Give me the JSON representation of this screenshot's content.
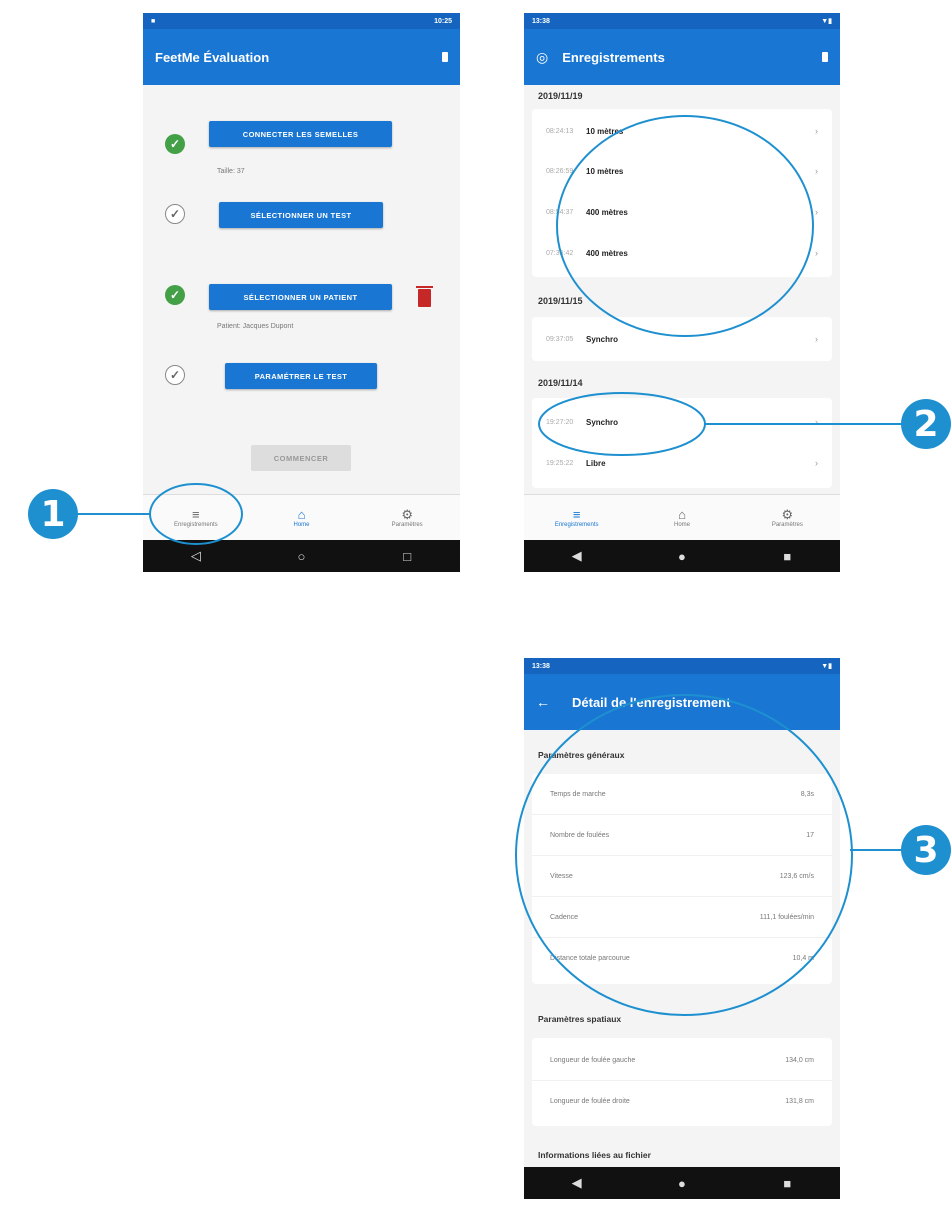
{
  "phone1": {
    "status_time": "10:25",
    "app_title": "FeetMe Évaluation",
    "connect_button": "CONNECTER LES SEMELLES",
    "size_text": "Taille: 37",
    "select_test_button": "SÉLECTIONNER UN TEST",
    "select_patient_button": "SÉLECTIONNER UN PATIENT",
    "patient_text": "Patient: Jacques Dupont",
    "configure_test_button": "PARAMÉTRER LE TEST",
    "start_button": "COMMENCER",
    "nav": [
      {
        "label": "Enregistrements",
        "icon": "list-icon"
      },
      {
        "label": "Home",
        "icon": "home-icon"
      },
      {
        "label": "Paramètres",
        "icon": "gear-icon"
      }
    ]
  },
  "phone2": {
    "status_time": "13:38",
    "app_title": "Enregistrements",
    "groups": [
      {
        "date": "2019/11/19",
        "items": [
          {
            "time": "08:24:13",
            "name": "10 mètres"
          },
          {
            "time": "08:26:59",
            "name": "10 mètres"
          },
          {
            "time": "08:54:37",
            "name": "400 mètres"
          },
          {
            "time": "07:35:42",
            "name": "400 mètres"
          }
        ]
      },
      {
        "date": "2019/11/15",
        "items": [
          {
            "time": "09:37:05",
            "name": "Synchro"
          }
        ]
      },
      {
        "date": "2019/11/14",
        "items": [
          {
            "time": "19:27:20",
            "name": "Synchro"
          },
          {
            "time": "19:25:22",
            "name": "Libre"
          }
        ]
      }
    ],
    "nav": [
      {
        "label": "Enregistrements",
        "icon": "list-icon"
      },
      {
        "label": "Home",
        "icon": "home-icon"
      },
      {
        "label": "Paramètres",
        "icon": "gear-icon"
      }
    ]
  },
  "phone3": {
    "status_time": "13:38",
    "app_title": "Détail de l'enregistrement",
    "general_title": "Paramètres généraux",
    "general": [
      {
        "label": "Temps de marche",
        "value": "8,3s"
      },
      {
        "label": "Nombre de foulées",
        "value": "17"
      },
      {
        "label": "Vitesse",
        "value": "123,6 cm/s"
      },
      {
        "label": "Cadence",
        "value": "111,1 foulées/min"
      },
      {
        "label": "Distance totale parcourue",
        "value": "10,4 m"
      }
    ],
    "spatial_title": "Paramètres spatiaux",
    "spatial": [
      {
        "label": "Longueur de foulée gauche",
        "value": "134,0 cm"
      },
      {
        "label": "Longueur de foulée droite",
        "value": "131,8 cm"
      }
    ],
    "file_title": "Informations liées au fichier"
  },
  "annotations": {
    "badge1": "1",
    "badge2": "2",
    "badge3": "3",
    "color": "#1e90d0"
  },
  "colors": {
    "appbar": "#1976d2",
    "statusbar": "#1565c0",
    "success": "#43a047",
    "delete": "#c62828"
  }
}
